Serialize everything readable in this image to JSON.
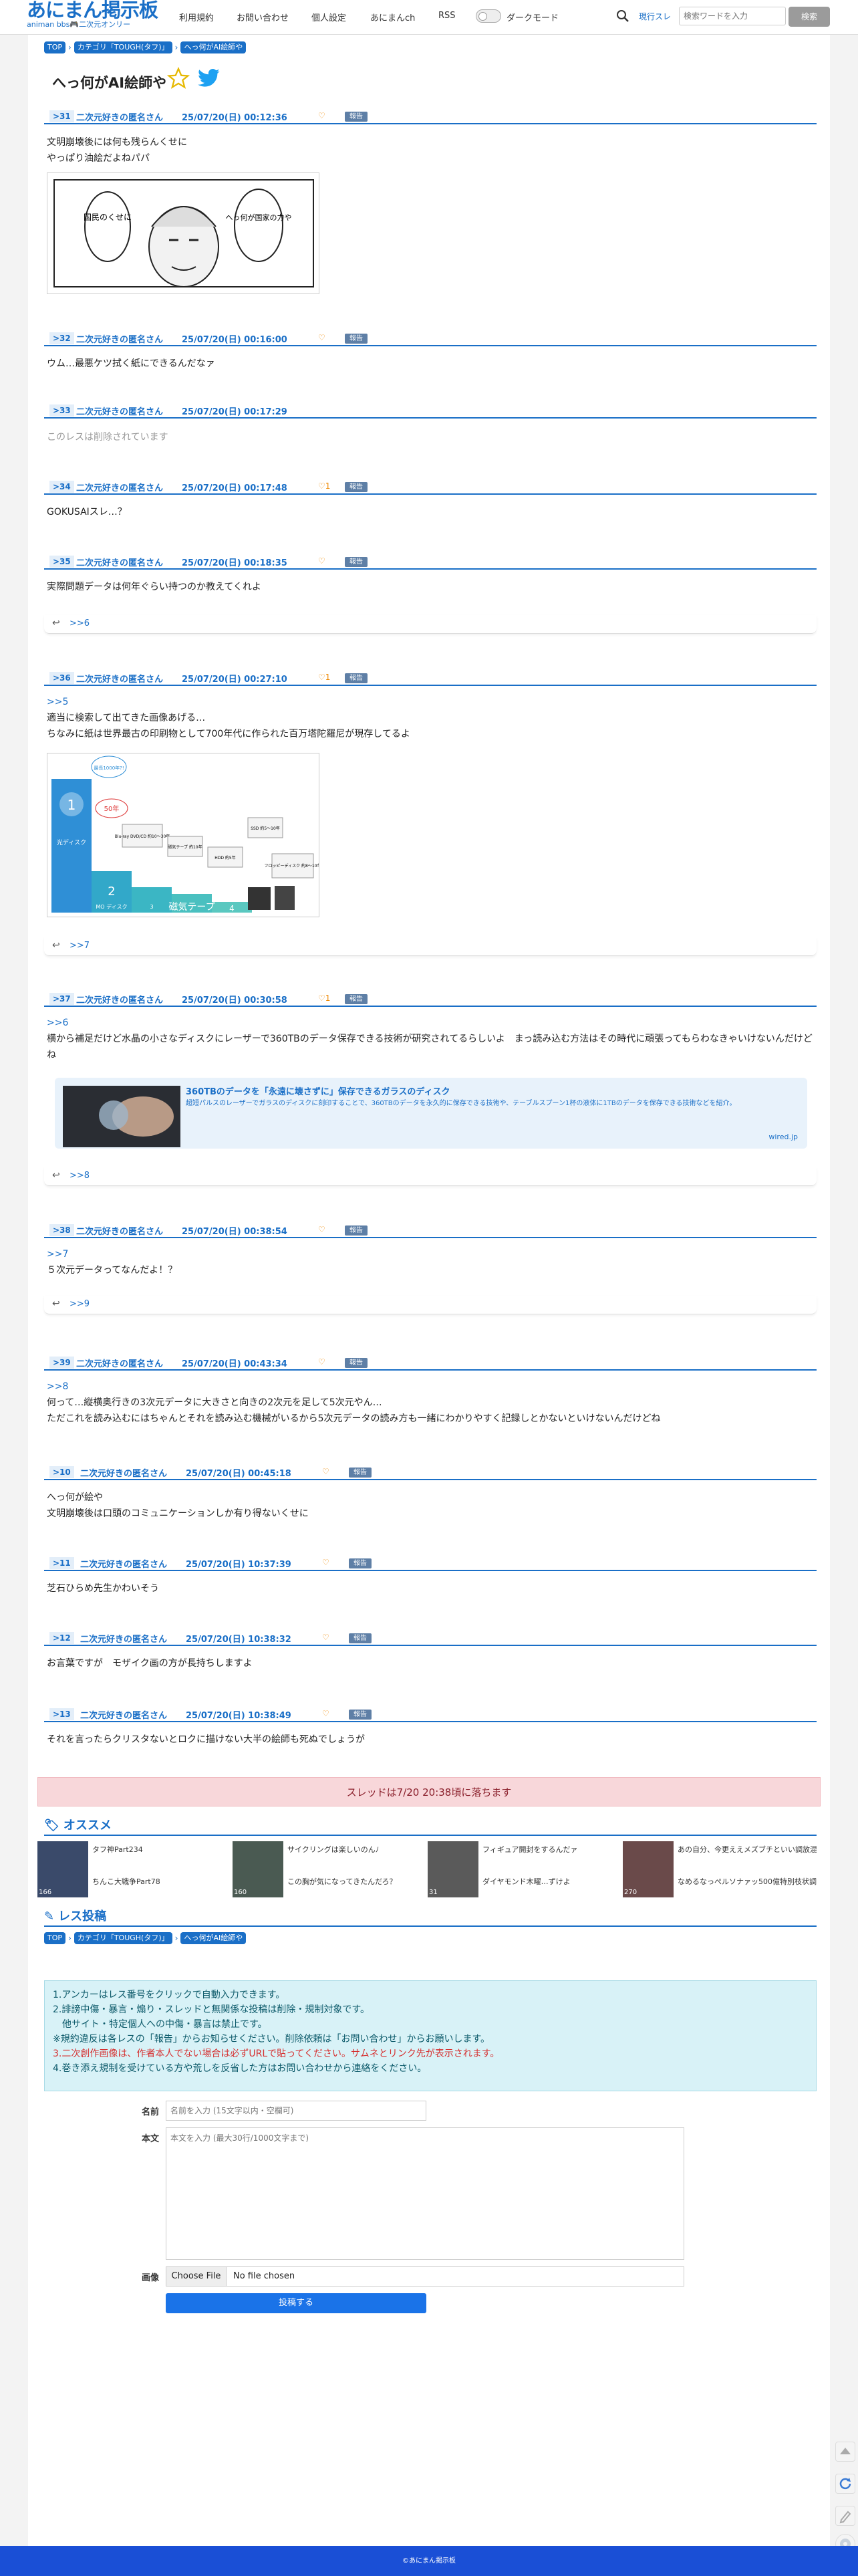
{
  "site": {
    "title": "あにまん掲示板",
    "subtitle": "animan bbs🎮二次元オンリー"
  },
  "nav": [
    "利用規約",
    "お問い合わせ",
    "個人設定",
    "あにまんch",
    "RSS",
    "ダークモード"
  ],
  "search": {
    "scope": "現行スレ",
    "placeholder": "検索ワードを入力",
    "button": "検索"
  },
  "breadcrumb": [
    "TOP",
    "カテゴリ「TOUGH(タフ)」",
    "へっ何がAI絵師や"
  ],
  "thread_title": "へっ何がAI絵師や",
  "report_label": "報告",
  "reply_arrow": "↩",
  "posts": [
    {
      "no": ">31",
      "name": "二次元好きの匿名さん",
      "date": "25/07/20(日) 00:12:36",
      "likes": "♡",
      "text": [
        "文明崩壊後には何も残らんくせに",
        "やっぱり油絵だよねパパ"
      ]
    },
    {
      "no": ">32",
      "name": "二次元好きの匿名さん",
      "date": "25/07/20(日) 00:16:00",
      "likes": "♡",
      "text": [
        "ウム…最悪ケツ拭く紙にできるんだなァ"
      ]
    },
    {
      "no": ">33",
      "name": "二次元好きの匿名さん",
      "date": "25/07/20(日) 00:17:29",
      "likes": "",
      "text": [
        "このレスは削除されています"
      ]
    },
    {
      "no": ">34",
      "name": "二次元好きの匿名さん",
      "date": "25/07/20(日) 00:17:48",
      "likes": "♡1",
      "text": [
        "GOKUSAIスレ…？"
      ]
    },
    {
      "no": ">35",
      "name": "二次元好きの匿名さん",
      "date": "25/07/20(日) 00:18:35",
      "likes": "♡",
      "text": [
        "実際問題データは何年ぐらい持つのか教えてくれよ"
      ],
      "reply": ">>6"
    },
    {
      "no": ">36",
      "name": "二次元好きの匿名さん",
      "date": "25/07/20(日) 00:27:10",
      "likes": "♡1",
      "anchor": ">>5",
      "text": [
        "適当に検索して出てきた画像あげる…",
        "ちなみに紙は世界最古の印刷物として700年代に作られた百万塔陀羅尼が現存してるよ"
      ],
      "reply": ">>7"
    },
    {
      "no": ">37",
      "name": "二次元好きの匿名さん",
      "date": "25/07/20(日) 00:30:58",
      "likes": "♡1",
      "anchor": ">>6",
      "text": [
        "横から補足だけど水晶の小さなディスクにレーザーで360TBのデータ保存できる技術が研究されてるらしいよ　まっ読み込む方法はその時代に頑張ってもらわなきゃいけないんだけどね"
      ],
      "reply": ">>8"
    },
    {
      "no": ">38",
      "name": "二次元好きの匿名さん",
      "date": "25/07/20(日) 00:38:54",
      "likes": "♡",
      "anchor": ">>7",
      "text": [
        "５次元データってなんだよ！？"
      ],
      "reply": ">>9"
    },
    {
      "no": ">39",
      "name": "二次元好きの匿名さん",
      "date": "25/07/20(日) 00:43:34",
      "likes": "♡",
      "anchor": ">>8",
      "text": [
        "何って…縦横奥行きの3次元データに大きさと向きの2次元を足して5次元やん…",
        "ただこれを読み込むにはちゃんとそれを読み込む機械がいるから5次元データの読み方も一緒にわかりやすく記録しとかないといけないんだけどね"
      ]
    },
    {
      "no": ">10",
      "name": "二次元好きの匿名さん",
      "date": "25/07/20(日) 00:45:18",
      "likes": "♡",
      "text": [
        "へっ何が絵や",
        "文明崩壊後は口頭のコミュニケーションしか有り得ないくせに"
      ]
    },
    {
      "no": ">11",
      "name": "二次元好きの匿名さん",
      "date": "25/07/20(日) 10:37:39",
      "likes": "♡",
      "text": [
        "芝石ひらめ先生かわいそう"
      ]
    },
    {
      "no": ">12",
      "name": "二次元好きの匿名さん",
      "date": "25/07/20(日) 10:38:32",
      "likes": "♡",
      "text": [
        "お言葉ですが　モザイク画の方が長持ちしますよ"
      ]
    },
    {
      "no": ">13",
      "name": "二次元好きの匿名さん",
      "date": "25/07/20(日) 10:38:49",
      "likes": "♡",
      "text": [
        "それを言ったらクリスタないとロクに描けない大半の絵師も死ぬでしょうが"
      ]
    }
  ],
  "manga_bubbles": [
    "国民のくせに",
    "へっ何が国家の力や"
  ],
  "disc_image": {
    "labels": [
      "1",
      "光ディスク",
      "2",
      "MO ディスク",
      "3",
      "磁気テープ",
      "4",
      "5"
    ],
    "callouts": [
      "最長1000年?!",
      "50年",
      "Blu-ray DVD/CD 約10〜30年",
      "磁気テープ 約10年",
      "HDD 約5年",
      "SSD 約5〜10年",
      "フロッピーディスク 約8〜10年"
    ]
  },
  "link_card": {
    "title": "360TBのデータを「永遠に壊さずに」保存できるガラスのディスク",
    "desc": "超短パルスのレーザーでガラスのディスクに刻印することで、360TBのデータを永久的に保存できる技術や、テーブルスプーン1杯の液体に1TBのデータを保存できる技術などを紹介。",
    "domain": "wired.jp"
  },
  "drop_notice": "スレッドは7/20 20:38頃に落ちます",
  "recommend": {
    "heading": "オススメ",
    "items": [
      {
        "title1": "タフ神Part234",
        "title2": "ちんこ大戦争Part78",
        "count": "166"
      },
      {
        "title1": "サイクリングは楽しいのんﾉ",
        "title2": "この胸が気になってきたんだろ？",
        "count": "160"
      },
      {
        "title1": "フィギュア開封をするんだァ",
        "title2": "ダイヤモンド木曜…ずけよ",
        "count": "31"
      },
      {
        "title1": "あの自分、今更ええメズブチといい調放混なんスよ",
        "title2": "なめるなっぺルソナァッ500億特別枝状調査Ⅹ part18",
        "count": "270"
      }
    ]
  },
  "post_form": {
    "heading": "レス投稿",
    "notice": [
      "1.アンカーはレス番号をクリックで自動入力できます。",
      "2.誹謗中傷・暴言・煽り・スレッドと無関係な投稿は削除・規制対象です。",
      "　他サイト・特定個人への中傷・暴言は禁止です。",
      "※規約違反は各レスの「報告」からお知らせください。削除依頼は「お問い合わせ」からお願いします。",
      "3.二次創作画像は、作者本人でない場合は必ずURLで貼ってください。サムネとリンク先が表示されます。",
      "4.巻き添え規制を受けている方や荒しを反省した方はお問い合わせから連絡をください。"
    ],
    "name_label": "名前",
    "name_placeholder": "名前を入力 (15文字以内・空欄可)",
    "body_label": "本文",
    "body_placeholder": "本文を入力 (最大30行/1000文字まで)",
    "image_label": "画像",
    "file_button": "Choose File",
    "file_status": "No file chosen",
    "submit": "投稿する"
  },
  "footer": "©あにまん掲示板",
  "colors": {
    "accent": "#1a6fc7",
    "report": "#5e7fa6",
    "like": "#ee8800",
    "notice_bg": "#d8f2f7",
    "drop_bg": "#f8d7da",
    "footer_bg": "#1a4fd6"
  }
}
